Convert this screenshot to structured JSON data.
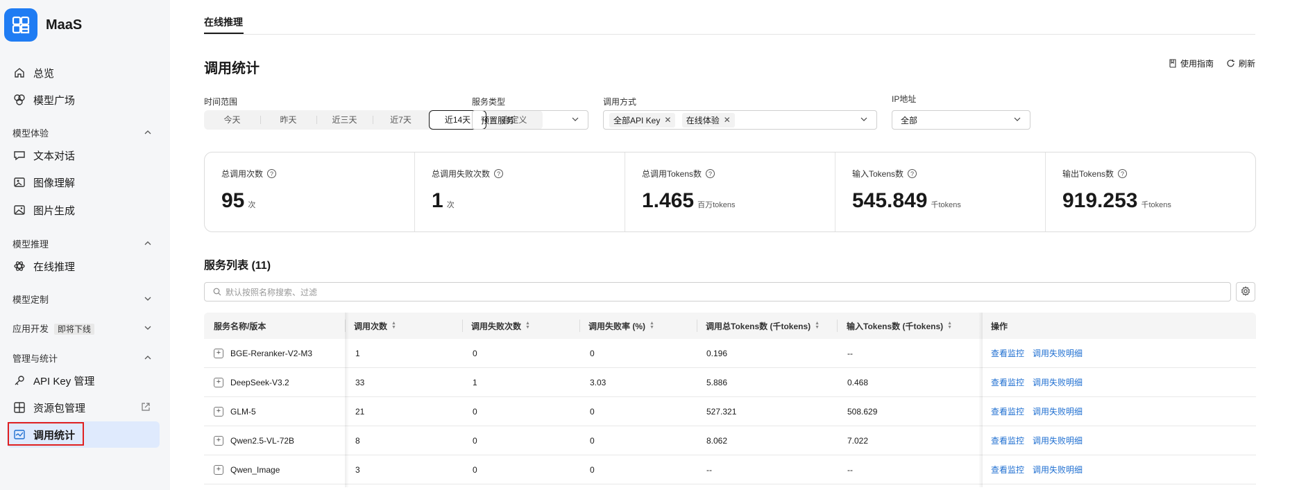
{
  "brand": {
    "name": "MaaS"
  },
  "nav": {
    "overview": "总览",
    "model_plaza": "模型广场",
    "group_experience": "模型体验",
    "text_chat": "文本对话",
    "image_understanding": "图像理解",
    "image_generation": "图片生成",
    "group_inference": "模型推理",
    "online_inference": "在线推理",
    "group_custom": "模型定制",
    "group_app_dev": "应用开发",
    "app_dev_badge": "即将下线",
    "group_manage": "管理与统计",
    "api_key": "API Key 管理",
    "resource_pack": "资源包管理",
    "usage_stats": "调用统计"
  },
  "tabs": {
    "online_inference": "在线推理"
  },
  "page": {
    "title": "调用统计",
    "guide": "使用指南",
    "refresh": "刷新"
  },
  "filters": {
    "time_label": "时间范围",
    "time_options": [
      "今天",
      "昨天",
      "近三天",
      "近7天",
      "近14天",
      "自定义"
    ],
    "service_type_label": "服务类型",
    "service_type_value": "预置服务",
    "call_method_label": "调用方式",
    "call_method_tags": [
      "全部API Key",
      "在线体验"
    ],
    "ip_label": "IP地址",
    "ip_value": "全部"
  },
  "stats": [
    {
      "label": "总调用次数",
      "value": "95",
      "unit": "次"
    },
    {
      "label": "总调用失败次数",
      "value": "1",
      "unit": "次"
    },
    {
      "label": "总调用Tokens数",
      "value": "1.465",
      "unit": "百万tokens"
    },
    {
      "label": "输入Tokens数",
      "value": "545.849",
      "unit": "千tokens"
    },
    {
      "label": "输出Tokens数",
      "value": "919.253",
      "unit": "千tokens"
    }
  ],
  "service_list": {
    "title": "服务列表 (11)",
    "search_placeholder": "默认按照名称搜索、过滤"
  },
  "table": {
    "headers": [
      "服务名称/版本",
      "调用次数",
      "调用失败次数",
      "调用失败率 (%)",
      "调用总Tokens数 (千tokens)",
      "输入Tokens数 (千tokens)",
      "操作"
    ],
    "action_monitor": "查看监控",
    "action_fail_detail": "调用失败明细",
    "rows": [
      {
        "name": "BGE-Reranker-V2-M3",
        "calls": "1",
        "fails": "0",
        "fail_rate": "0",
        "total_tokens": "0.196",
        "input_tokens": "--"
      },
      {
        "name": "DeepSeek-V3.2",
        "calls": "33",
        "fails": "1",
        "fail_rate": "3.03",
        "total_tokens": "5.886",
        "input_tokens": "0.468"
      },
      {
        "name": "GLM-5",
        "calls": "21",
        "fails": "0",
        "fail_rate": "0",
        "total_tokens": "527.321",
        "input_tokens": "508.629"
      },
      {
        "name": "Qwen2.5-VL-72B",
        "calls": "8",
        "fails": "0",
        "fail_rate": "0",
        "total_tokens": "8.062",
        "input_tokens": "7.022"
      },
      {
        "name": "Qwen_Image",
        "calls": "3",
        "fails": "0",
        "fail_rate": "0",
        "total_tokens": "--",
        "input_tokens": "--"
      }
    ]
  }
}
